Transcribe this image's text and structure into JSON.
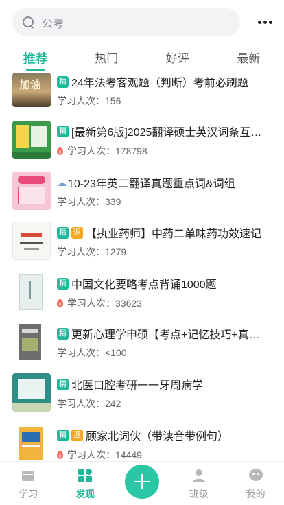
{
  "search": {
    "placeholder": "公考"
  },
  "tabs": [
    {
      "label": "推荐",
      "active": true
    },
    {
      "label": "热门",
      "active": false
    },
    {
      "label": "好评",
      "active": false
    },
    {
      "label": "最新",
      "active": false
    }
  ],
  "items": [
    {
      "title": "24年法考客观题（判断）考前必刷题",
      "badges": [
        "精"
      ],
      "meta_label": "学习人次：",
      "meta_value": "156",
      "hot": false,
      "thumb": "bg-sunset"
    },
    {
      "title": "[最新第6版]2025翻译硕士英汉词条互…",
      "badges": [
        "精"
      ],
      "meta_label": "学习人次：",
      "meta_value": "178798",
      "hot": true,
      "thumb": "bg-green-book"
    },
    {
      "title": "10-23年英二翻译真题重点词&词组",
      "badges": [],
      "emoji": "cloud-icon",
      "meta_label": "学习人次：",
      "meta_value": "339",
      "hot": false,
      "thumb": "bg-pink"
    },
    {
      "title": "【执业药师】中药二单味药功效速记",
      "badges": [
        "精",
        "返"
      ],
      "meta_label": "学习人次：",
      "meta_value": "1279",
      "hot": false,
      "thumb": "bg-white-book"
    },
    {
      "title": "中国文化要略考点背诵1000题",
      "badges": [
        "精"
      ],
      "meta_label": "学习人次：",
      "meta_value": "33623",
      "hot": true,
      "thumb": "bg-light-book"
    },
    {
      "title": "更新心理学申硕【考点+记忆技巧+真…",
      "badges": [
        "精"
      ],
      "meta_label": "学习人次：",
      "meta_value": "<100",
      "hot": false,
      "thumb": "bg-grey-book"
    },
    {
      "title": "北医口腔考研一一牙周病学",
      "badges": [
        "精"
      ],
      "meta_label": "学习人次：",
      "meta_value": "242",
      "hot": false,
      "thumb": "bg-teal-card"
    },
    {
      "title": "顾家北词伙（带读音带例句）",
      "badges": [
        "精",
        "返"
      ],
      "meta_label": "学习人次：",
      "meta_value": "14449",
      "hot": true,
      "thumb": "bg-orange-book"
    }
  ],
  "nav": [
    {
      "label": "学习",
      "icon": "book-icon",
      "active": false
    },
    {
      "label": "发现",
      "icon": "grid-icon",
      "active": true
    },
    {
      "label": "",
      "icon": "plus-icon",
      "active": false
    },
    {
      "label": "班级",
      "icon": "people-icon",
      "active": false
    },
    {
      "label": "我的",
      "icon": "profile-icon",
      "active": false
    }
  ],
  "colors": {
    "accent": "#1fb89a",
    "badge_jing": "#1fb89a",
    "badge_fan": "#f5a623",
    "hot": "#f26b5b"
  }
}
